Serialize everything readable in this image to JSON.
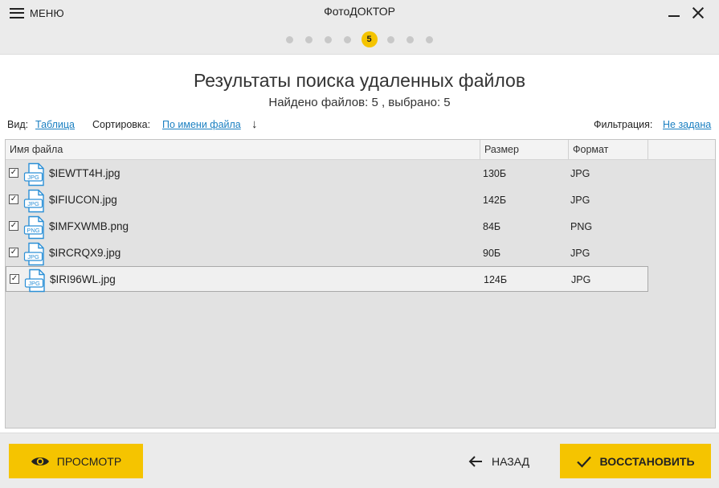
{
  "header": {
    "menu_label": "МЕНЮ",
    "app_title": "ФотоДОКТОР",
    "steps_total": 8,
    "current_step": "5"
  },
  "main": {
    "title": "Результаты поиска удаленных файлов",
    "subtitle": "Найдено файлов: 5 , выбрано: 5"
  },
  "toolbar": {
    "view_label": "Вид:",
    "view_value": "Таблица",
    "sort_label": "Сортировка:",
    "sort_value": "По имени файла",
    "sort_arrow": "↓",
    "filter_label": "Фильтрация:",
    "filter_value": "Не задана"
  },
  "table": {
    "columns": [
      "Имя файла",
      "Размер",
      "Формат"
    ],
    "rows": [
      {
        "checked": "✓",
        "icon": "jpg-file-icon",
        "icon_label": "JPG",
        "name": "$IEWTT4H.jpg",
        "size": "130Б",
        "format": "JPG"
      },
      {
        "checked": "✓",
        "icon": "jpg-file-icon",
        "icon_label": "JPG",
        "name": "$IFIUCON.jpg",
        "size": "142Б",
        "format": "JPG"
      },
      {
        "checked": "✓",
        "icon": "png-file-icon",
        "icon_label": "PNG",
        "name": "$IMFXWMB.png",
        "size": "84Б",
        "format": "PNG"
      },
      {
        "checked": "✓",
        "icon": "jpg-file-icon",
        "icon_label": "JPG",
        "name": "$IRCRQX9.jpg",
        "size": "90Б",
        "format": "JPG"
      },
      {
        "checked": "✓",
        "icon": "jpg-file-icon",
        "icon_label": "JPG",
        "name": "$IRI96WL.jpg",
        "size": "124Б",
        "format": "JPG"
      }
    ],
    "selected_row": 4
  },
  "footer": {
    "preview_label": "ПРОСМОТР",
    "back_label": "НАЗАД",
    "restore_label": "ВОССТАНОВИТЬ"
  },
  "colors": {
    "accent": "#f5c400",
    "link": "#1a7fc1",
    "icon_blue": "#2a8fd6"
  }
}
